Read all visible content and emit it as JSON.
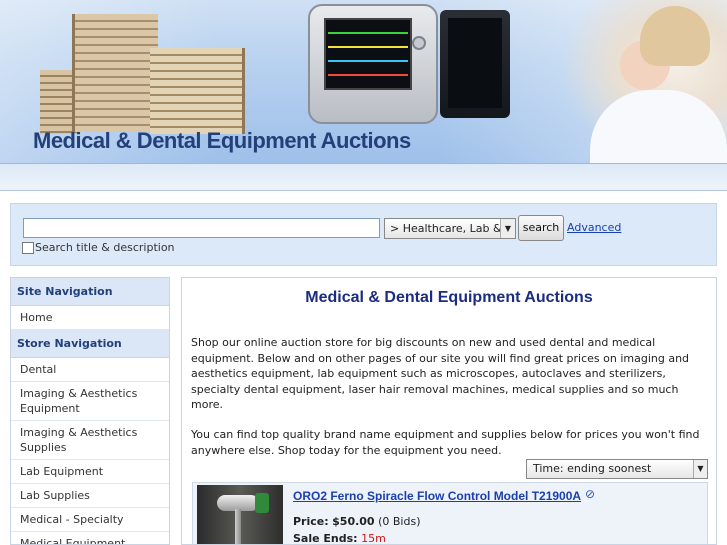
{
  "header": {
    "site_title": "Medical & Dental Equipment Auctions"
  },
  "search": {
    "input_value": "",
    "category_selected": "> Healthcare, Lab & L",
    "button_label": "search",
    "advanced_link": "Advanced",
    "title_desc_label": "Search title & description",
    "title_desc_checked": false
  },
  "sidebar": {
    "site_nav_heading": "Site Navigation",
    "site_nav_items": [
      "Home"
    ],
    "store_nav_heading": "Store Navigation",
    "store_nav_items": [
      "Dental",
      "Imaging & Aesthetics Equipment",
      "Imaging & Aesthetics Supplies",
      "Lab Equipment",
      "Lab Supplies",
      "Medical - Specialty",
      "Medical Equipment"
    ]
  },
  "main": {
    "title": "Medical & Dental Equipment Auctions",
    "paragraph_1": "Shop our online auction store for big discounts on new and used dental and medical equipment. Below and on other pages of our site you will find great prices on imaging and aesthetics equipment, lab equipment such as microscopes, autoclaves and sterilizers, specialty dental equipment, laser hair removal machines, medical supplies and so much more.",
    "paragraph_2": "You can find top quality brand name equipment and supplies below for prices you won't find anywhere else. Shop today for the equipment you need.",
    "sort_selected": "Time: ending soonest",
    "listings": [
      {
        "title": "ORO2 Ferno Spiracle Flow Control Model T21900A",
        "price_label": "Price:",
        "price_value": "$50.00",
        "bids": "(0 Bids)",
        "ends_label": "Sale Ends:",
        "ends_value": "15m",
        "icon": "paperclip-icon"
      }
    ]
  },
  "colors": {
    "title_blue": "#24407a",
    "link_blue": "#1a3fb0",
    "heading_navy": "#1c2c80",
    "nav_header_bg": "#dbe7f6",
    "search_bg": "#dce9f8",
    "sale_red": "#d21414"
  }
}
